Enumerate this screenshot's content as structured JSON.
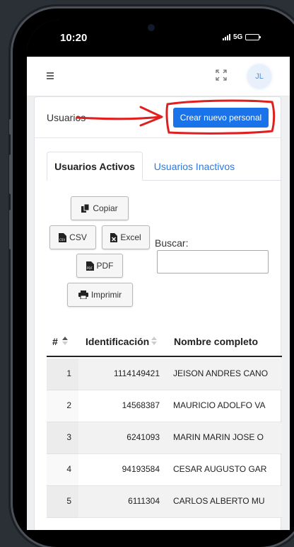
{
  "status_bar": {
    "time": "10:20",
    "network": "5G"
  },
  "navbar": {
    "avatar_initials": "JL"
  },
  "card": {
    "title": "Usuarios",
    "create_button": "Crear nuevo personal"
  },
  "tabs": [
    {
      "label": "Usuarios Activos",
      "active": true
    },
    {
      "label": "Usuarios Inactivos",
      "active": false
    }
  ],
  "toolbar": {
    "copy": "Copiar",
    "csv": "CSV",
    "excel": "Excel",
    "pdf": "PDF",
    "print": "Imprimir",
    "search_label": "Buscar:",
    "search_value": ""
  },
  "table": {
    "columns": [
      "#",
      "Identificación",
      "Nombre completo"
    ],
    "rows": [
      {
        "num": "1",
        "id": "1114149421",
        "name": "JEISON ANDRES CANO"
      },
      {
        "num": "2",
        "id": "14568387",
        "name": "MAURICIO ADOLFO VA"
      },
      {
        "num": "3",
        "id": "6241093",
        "name": "MARIN MARIN JOSE O"
      },
      {
        "num": "4",
        "id": "94193584",
        "name": "CESAR AUGUSTO GAR"
      },
      {
        "num": "5",
        "id": "6111304",
        "name": "CARLOS ALBERTO MU"
      }
    ]
  },
  "colors": {
    "primary": "#1a73e8",
    "link": "#2a7ae2",
    "annotation": "#e02020"
  }
}
